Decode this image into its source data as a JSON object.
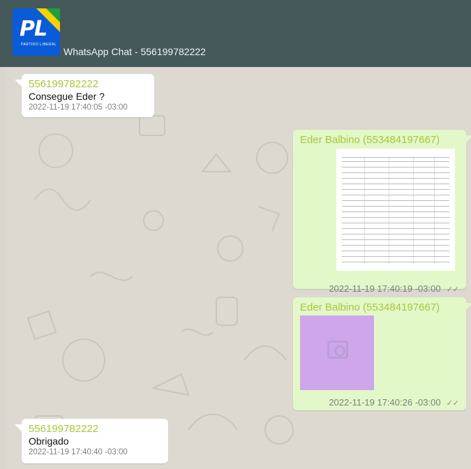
{
  "window": {
    "title": "WhatsApp Chat - 556199782222",
    "logo_text": "PL",
    "logo_subtext": "PARTIDO LIBERAL"
  },
  "messages": [
    {
      "direction": "incoming",
      "sender": "556199782222",
      "text": "Consegue Eder ?",
      "timestamp": "2022-11-19 17:40:05 -03:00"
    },
    {
      "direction": "outgoing",
      "sender": "Eder Balbino (553484197667)",
      "attachment": "document-preview",
      "timestamp": "2022-11-19 17:40:19 -03:00",
      "status": "✓✓"
    },
    {
      "direction": "outgoing",
      "sender": "Eder Balbino (553484197667)",
      "attachment": "camera-icon",
      "timestamp": "2022-11-19 17:40:26 -03:00",
      "status": "✓✓"
    },
    {
      "direction": "incoming",
      "sender": "556199782222",
      "text": "Obrigado",
      "timestamp": "2022-11-19 17:40:40 -03:00"
    }
  ],
  "colors": {
    "header": "#45595b",
    "incoming_bubble": "#ffffff",
    "outgoing_bubble": "#e2f8c8",
    "sender_name": "#a9c53b",
    "photo_placeholder": "#cfa6ea"
  }
}
